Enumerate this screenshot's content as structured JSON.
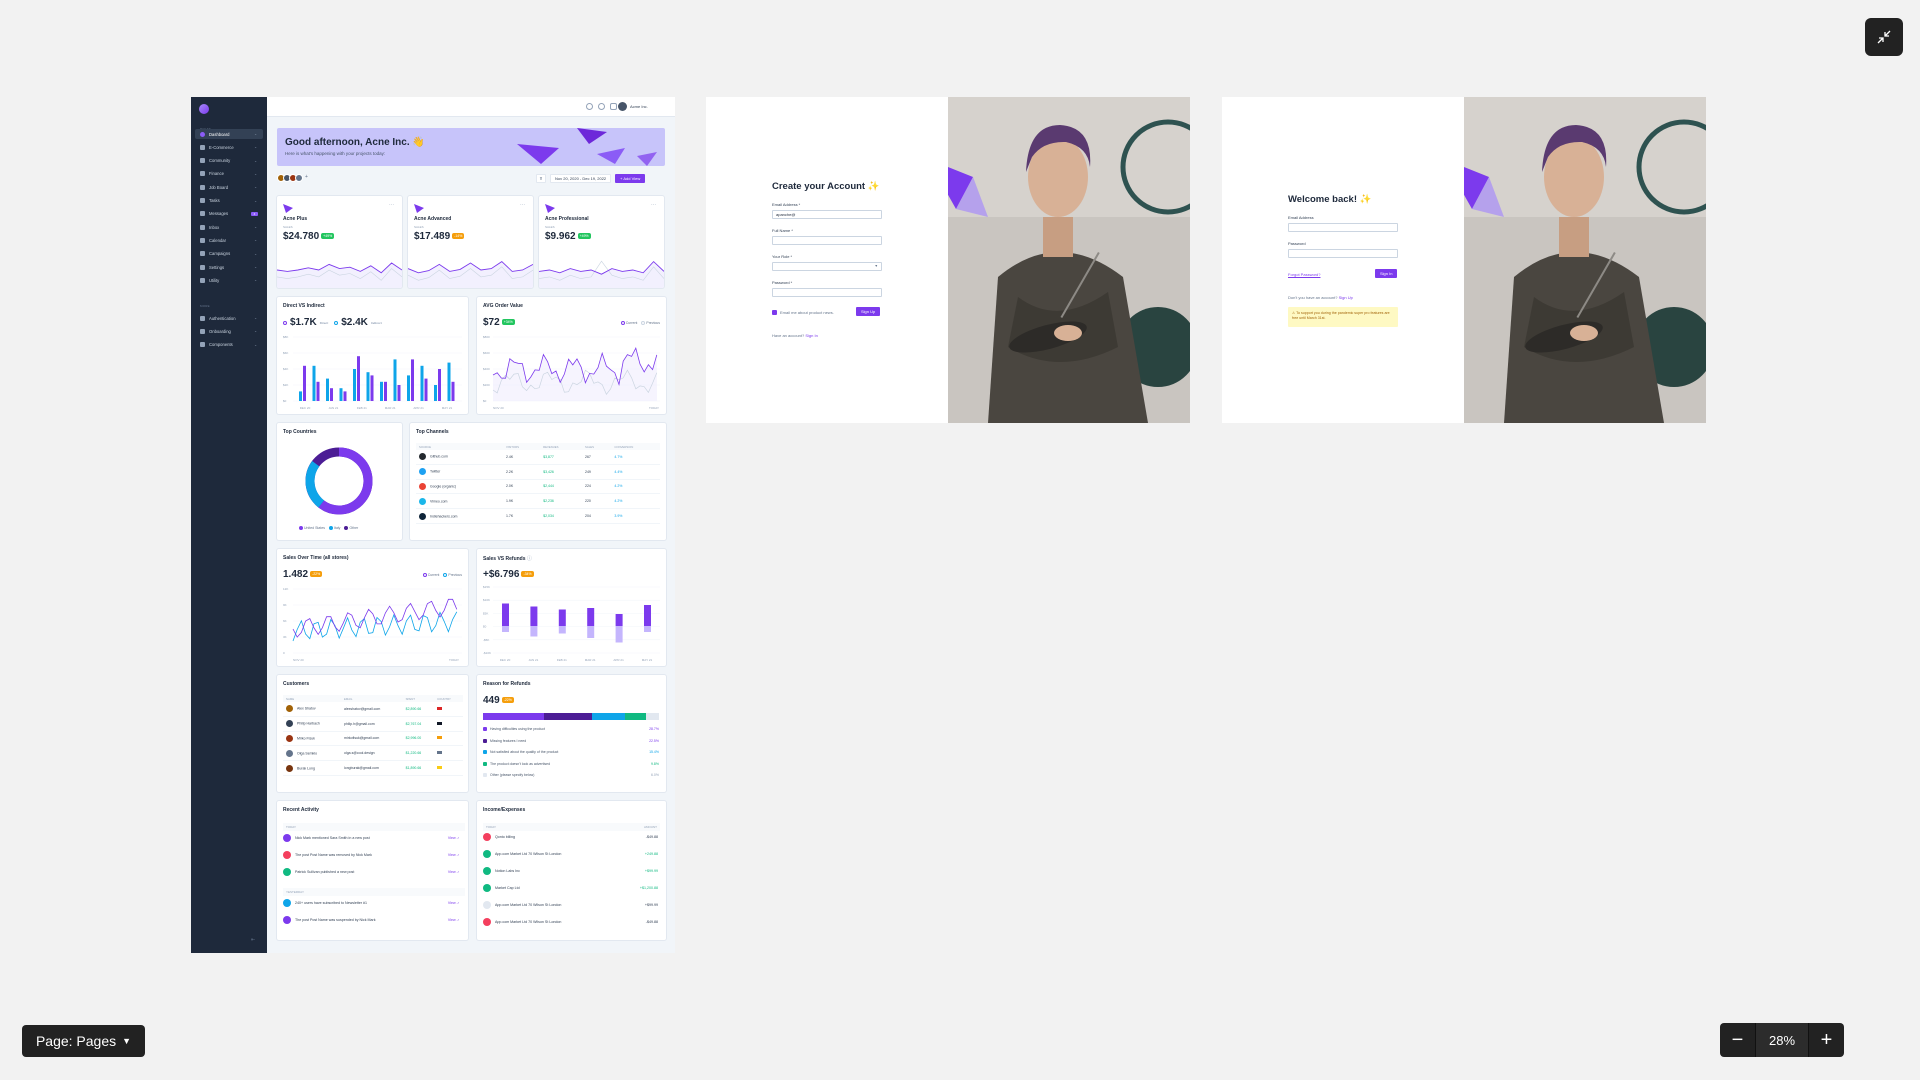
{
  "viewer": {
    "page_selector": "Page: Pages",
    "zoom": "28%",
    "zoom_out": "−",
    "zoom_in": "+"
  },
  "dashboard": {
    "sidebar": {
      "heading_pages": "PAGES",
      "heading_more": "MORE",
      "items": [
        {
          "label": "Dashboard",
          "active": true
        },
        {
          "label": "E-Commerce"
        },
        {
          "label": "Community"
        },
        {
          "label": "Finance"
        },
        {
          "label": "Job Board"
        },
        {
          "label": "Tasks"
        },
        {
          "label": "Messages",
          "badge": "4"
        },
        {
          "label": "Inbox"
        },
        {
          "label": "Calendar"
        },
        {
          "label": "Campaigns"
        },
        {
          "label": "Settings"
        },
        {
          "label": "Utility"
        }
      ],
      "more_items": [
        {
          "label": "Authentication"
        },
        {
          "label": "Onboarding"
        },
        {
          "label": "Components"
        }
      ]
    },
    "topbar": {
      "user": "Acme Inc."
    },
    "banner": {
      "title": "Good afternoon, Acne Inc. 👋",
      "subtitle": "Here is what's happening with your projects today:"
    },
    "actions": {
      "filter": "⊽",
      "date_range": "Nov 20, 2020 - Dec 19, 2022",
      "add_view": "+ Add View"
    },
    "kpis": [
      {
        "name": "Acne Plus",
        "sub": "SALES",
        "value": "$24.780",
        "change": "+49%",
        "tone": "green"
      },
      {
        "name": "Acne Advanced",
        "sub": "SALES",
        "value": "$17.489",
        "change": "-14%",
        "tone": "amber"
      },
      {
        "name": "Acne Professional",
        "sub": "SALES",
        "value": "$9.962",
        "change": "+49%",
        "tone": "green"
      }
    ],
    "direct_indirect": {
      "title": "Direct VS Indirect",
      "direct_value": "$1.7K",
      "direct_label": "Direct",
      "indirect_value": "$2.4K",
      "indirect_label": "Indirect",
      "y_ticks": [
        "$8K",
        "$6K",
        "$4K",
        "$2K",
        "$0"
      ],
      "x_ticks": [
        "DEC 20",
        "JAN 21",
        "FEB 21",
        "MAR 21",
        "APR 21",
        "MAY 21"
      ]
    },
    "aov": {
      "title": "AVG Order Value",
      "value": "$72",
      "change": "+34%",
      "legend_current": "Current",
      "legend_previous": "Previous",
      "y_ticks": [
        "$800",
        "$600",
        "$400",
        "$200",
        "$0"
      ],
      "x_start": "NOV 20",
      "x_end": "TODAY"
    },
    "countries": {
      "title": "Top Countries",
      "legend": [
        "United States",
        "Italy",
        "Other"
      ],
      "colors": [
        "#7c3aed",
        "#0ea5e9",
        "#4c1d95"
      ]
    },
    "channels": {
      "title": "Top Channels",
      "headers": [
        "SOURCE",
        "VISITORS",
        "REVENUES",
        "SALES",
        "CONVERSION"
      ],
      "rows": [
        {
          "source": "Github.com",
          "visitors": "2.4K",
          "revenue": "$3,877",
          "sales": "267",
          "conversion": "4.7%",
          "color": "#24292e"
        },
        {
          "source": "Twitter",
          "visitors": "2.2K",
          "revenue": "$3,426",
          "sales": "249",
          "conversion": "4.4%",
          "color": "#1da1f2"
        },
        {
          "source": "Google (organic)",
          "visitors": "2.0K",
          "revenue": "$2,444",
          "sales": "224",
          "conversion": "4.2%",
          "color": "#ea4335"
        },
        {
          "source": "Vimeo.com",
          "visitors": "1.9K",
          "revenue": "$2,236",
          "sales": "220",
          "conversion": "4.2%",
          "color": "#1ab7ea"
        },
        {
          "source": "Indiehackers.com",
          "visitors": "1.7K",
          "revenue": "$2,034",
          "sales": "204",
          "conversion": "3.9%",
          "color": "#0e2439"
        }
      ]
    },
    "sales_over_time": {
      "title": "Sales Over Time (all stores)",
      "value": "1.482",
      "change": "-22%",
      "legend_current": "Current",
      "legend_previous": "Previous",
      "y_ticks": [
        "12K",
        "9K",
        "6K",
        "3K",
        "0"
      ],
      "x_start": "NOV 20",
      "x_end": "TODAY"
    },
    "sales_refunds": {
      "title": "Sales VS Refunds",
      "value": "+$6.796",
      "change": "-34%",
      "y_ticks": [
        "$15K",
        "$10K",
        "$5K",
        "$0",
        "-$5K",
        "-$10K"
      ],
      "x_ticks": [
        "DEC 20",
        "JAN 21",
        "FEB 21",
        "MAR 21",
        "APR 21",
        "MAY 21"
      ]
    },
    "customers": {
      "title": "Customers",
      "headers": [
        "NAME",
        "EMAIL",
        "SPENT",
        "COUNTRY"
      ],
      "rows": [
        {
          "name": "Alex Shatov",
          "email": "alexshatov@gmail.com",
          "spent": "$2,890.66",
          "avatar": "#a16207"
        },
        {
          "name": "Philip Harbach",
          "email": "philip.h@gmail.com",
          "spent": "$2,767.04",
          "avatar": "#334155"
        },
        {
          "name": "Mirko Fisuk",
          "email": "mirkofisuk@gmail.com",
          "spent": "$2,996.00",
          "avatar": "#9a3412"
        },
        {
          "name": "Olga Semklo",
          "email": "olga.s@cool.design",
          "spent": "$1,220.66",
          "avatar": "#64748b"
        },
        {
          "name": "Burak Long",
          "email": "longburak@gmail.com",
          "spent": "$1,890.66",
          "avatar": "#78350f"
        }
      ]
    },
    "refunds": {
      "title": "Reason for Refunds",
      "value": "449",
      "change": "-22%",
      "segments": [
        {
          "label": "Having difficulties using the product",
          "pct": "28.7%",
          "share": 28.7,
          "color": "#7c3aed"
        },
        {
          "label": "Missing features I need",
          "pct": "22.5%",
          "share": 22.5,
          "color": "#4c1d95"
        },
        {
          "label": "Not satisfied about the quality of the product",
          "pct": "15.4%",
          "share": 15.4,
          "color": "#0ea5e9"
        },
        {
          "label": "The product doesn't look as advertised",
          "pct": "9.8%",
          "share": 9.8,
          "color": "#10b981"
        },
        {
          "label": "Other (please specify below)",
          "pct": "6.0%",
          "share": 6.0,
          "color": "#e2e8f0"
        }
      ]
    },
    "recent_activity": {
      "title": "Recent Activity",
      "today": "TODAY",
      "yesterday": "YESTERDAY",
      "view": "View -›",
      "today_rows": [
        {
          "text": "Nick Mark mentioned Sara Smith in a new post",
          "color": "#7c3aed"
        },
        {
          "text": "The post Post Name was removed by Nick Mark",
          "color": "#f43f5e"
        },
        {
          "text": "Patrick Sullivan published a new post",
          "color": "#10b981"
        }
      ],
      "yesterday_rows": [
        {
          "text": "240+ users have subscribed to Newsletter #1",
          "color": "#0ea5e9"
        },
        {
          "text": "The post Post Name was suspended by Nick Mark",
          "color": "#7c3aed"
        }
      ]
    },
    "income": {
      "title": "Income/Expenses",
      "today": "TODAY",
      "amount": "AMOUNT",
      "rows": [
        {
          "text": "Qonto billing",
          "amt": "-$49.88",
          "color": "#f43f5e",
          "tone": ""
        },
        {
          "text": "App.com Market Ltd 70 Wilson St London",
          "amt": "+249.88",
          "color": "#10b981",
          "tone": "green"
        },
        {
          "text": "Notion Labs Inc",
          "amt": "+$99.99",
          "color": "#10b981",
          "tone": "green"
        },
        {
          "text": "Market Cap Ltd",
          "amt": "+$1,200.88",
          "color": "#10b981",
          "tone": "green"
        },
        {
          "text": "App.com Market Ltd 70 Wilson St London",
          "amt": "+$99.99",
          "color": "#e2e8f0",
          "tone": ""
        },
        {
          "text": "App.com Market Ltd 70 Wilson St London",
          "amt": "-$49.88",
          "color": "#f43f5e",
          "tone": ""
        }
      ]
    }
  },
  "signup": {
    "title": "Create your Account ✨",
    "email_label": "Email Address *",
    "email_value": "apanche@",
    "name_label": "Full Name *",
    "role_label": "Your Role *",
    "password_label": "Password *",
    "newsletter_label": "Email me about product news.",
    "submit": "Sign Up",
    "footer_text": "Have an account?",
    "footer_link": "Sign In"
  },
  "signin": {
    "title": "Welcome back! ✨",
    "email_label": "Email Address",
    "password_label": "Password",
    "forgot": "Forgot Password?",
    "submit": "Sign In",
    "footer_text": "Don't you have an account?",
    "footer_link": "Sign Up",
    "warning": "⚠ To support you during the pandemic super pro features are free until March 31st."
  }
}
